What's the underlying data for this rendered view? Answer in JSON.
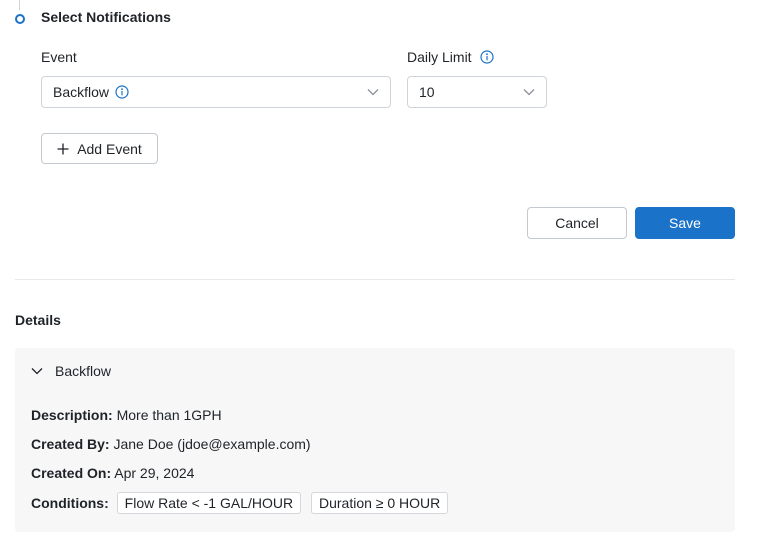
{
  "step": {
    "title": "Select Notifications"
  },
  "form": {
    "event_label": "Event",
    "event_value": "Backflow",
    "daily_limit_label": "Daily Limit",
    "daily_limit_value": "10",
    "add_event_label": "Add Event"
  },
  "actions": {
    "cancel_label": "Cancel",
    "save_label": "Save"
  },
  "details": {
    "title": "Details",
    "item_name": "Backflow",
    "description_label": "Description:",
    "description_value": "More than 1GPH",
    "created_by_label": "Created By:",
    "created_by_value": "Jane Doe (jdoe@example.com)",
    "created_on_label": "Created On:",
    "created_on_value": "Apr 29, 2024",
    "conditions_label": "Conditions:",
    "conditions": [
      "Flow Rate < -1 GAL/HOUR",
      "Duration ≥ 0 HOUR"
    ]
  },
  "colors": {
    "accent": "#1a73c8",
    "panel_bg": "#f7f7f8",
    "border": "#cfd4da"
  },
  "icons": [
    "step-dot-icon",
    "info-icon",
    "chevron-down-icon",
    "plus-icon"
  ]
}
